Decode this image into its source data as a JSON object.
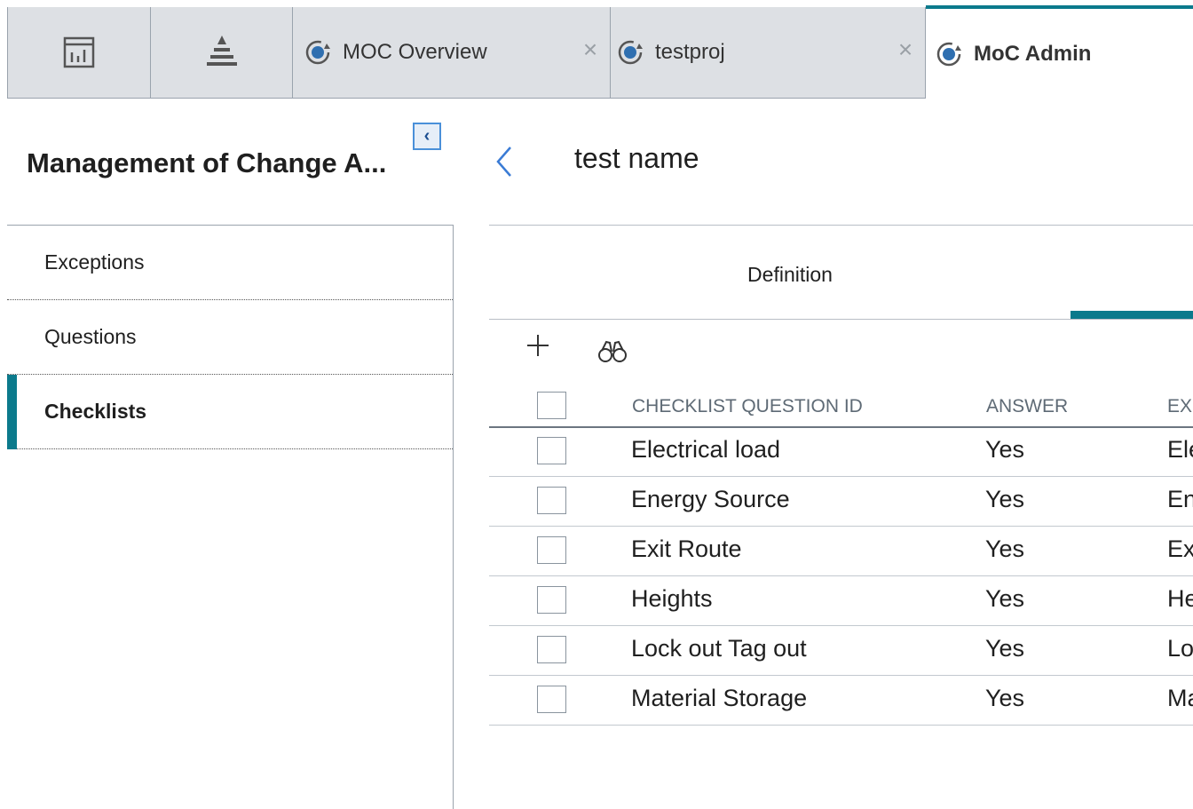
{
  "tabs": [
    {
      "type": "icon",
      "icon": "dashboard-icon"
    },
    {
      "type": "icon",
      "icon": "pyramid-icon"
    },
    {
      "type": "doc",
      "icon": "moc-refresh-icon",
      "label": "MOC Overview",
      "closable": true
    },
    {
      "type": "doc",
      "icon": "moc-refresh-icon",
      "label": "testproj",
      "closable": true
    },
    {
      "type": "doc",
      "icon": "moc-refresh-icon",
      "label": "MoC Admin",
      "active": true
    }
  ],
  "left_panel": {
    "title": "Management of Change A...",
    "collapse_icon": "chevron-left-icon",
    "nav_items": [
      "Exceptions",
      "Questions",
      "Checklists"
    ],
    "active_item": "Checklists"
  },
  "record": {
    "title": "test name",
    "back_icon": "chevron-left-icon"
  },
  "section_tabs": {
    "definition": "Definition"
  },
  "toolbar": {
    "add_icon": "plus-icon",
    "search_icon": "binoculars-icon"
  },
  "grid": {
    "columns": [
      "CHECKLIST QUESTION ID",
      "ANSWER",
      "EXC"
    ],
    "rows": [
      {
        "id": "Electrical load",
        "answer": "Yes",
        "exc": "Ele"
      },
      {
        "id": "Energy Source",
        "answer": "Yes",
        "exc": "En"
      },
      {
        "id": "Exit Route",
        "answer": "Yes",
        "exc": "Ex"
      },
      {
        "id": "Heights",
        "answer": "Yes",
        "exc": "He"
      },
      {
        "id": "Lock out Tag out",
        "answer": "Yes",
        "exc": "Lo"
      },
      {
        "id": "Material Storage",
        "answer": "Yes",
        "exc": "Ma"
      }
    ]
  },
  "colors": {
    "accent": "#0b7a8c",
    "tabbar_bg": "#dde0e4",
    "collapse_border": "#4a90d9"
  }
}
